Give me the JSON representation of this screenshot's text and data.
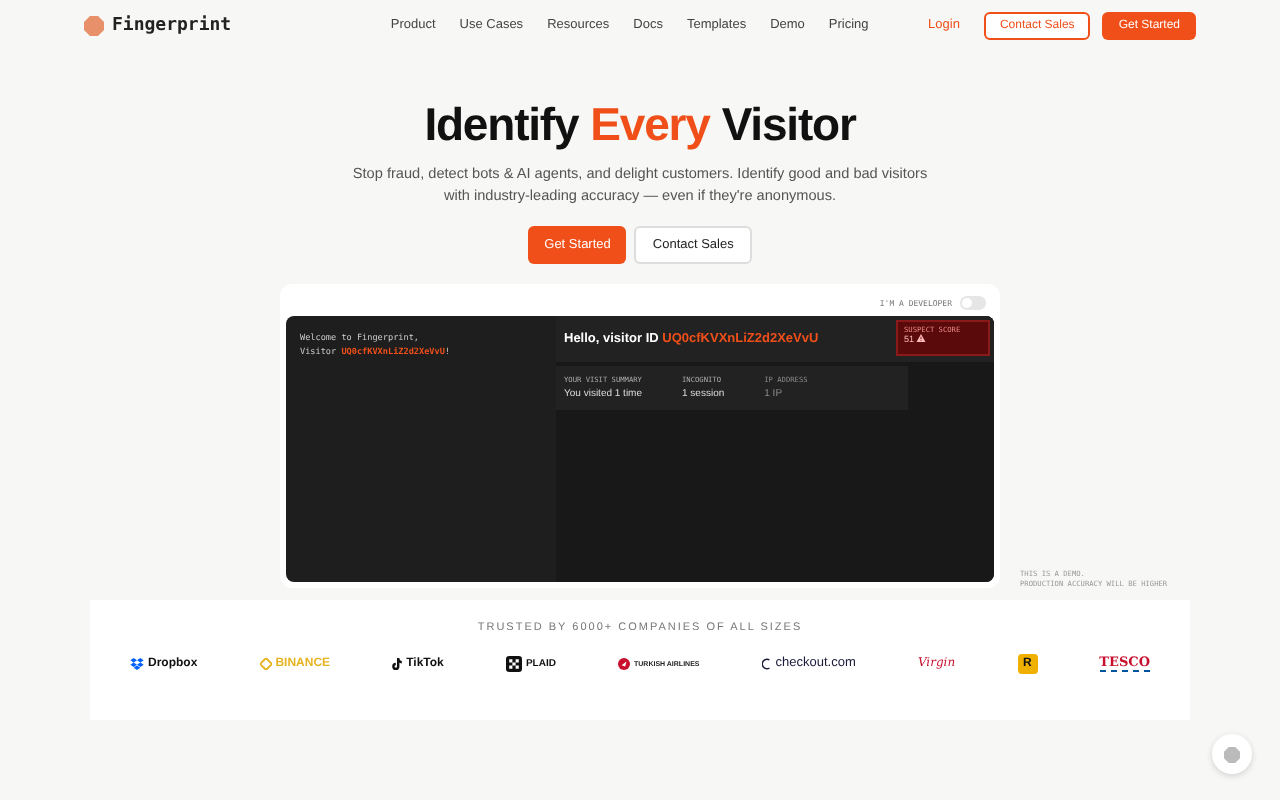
{
  "header": {
    "logo": "Fingerprint",
    "nav": [
      "Product",
      "Use Cases",
      "Resources",
      "Docs",
      "Templates",
      "Demo",
      "Pricing"
    ],
    "login": "Login",
    "contact": "Contact Sales",
    "cta": "Get Started"
  },
  "hero": {
    "title_parts": [
      {
        "text": "Identify",
        "highlighted": false
      },
      {
        "text": "Every",
        "highlighted": true
      },
      {
        "text": "Visitor",
        "highlighted": false
      }
    ],
    "subtitle": "Stop fraud, detect bots & AI agents, and delight customers. Identify good and bad visitors with industry-leading accuracy — even if they're anonymous.",
    "primary_button": "Get Started",
    "secondary_button": "Contact Sales"
  },
  "demo": {
    "developer_label": "I'M A DEVELOPER",
    "developer_on": false,
    "terminal": [
      "Welcome to Fingerprint,",
      "Visitor "
    ],
    "terminal_id": "UQ0cfKVXnLiZ2d2XeVvU",
    "terminal_end": "!",
    "greeting": "Hello, visitor ID",
    "visitor_id": "UQ0cfKVXnLiZ2d2XeVvU",
    "suspect": {
      "label": "SUSPECT SCORE",
      "value": "51"
    },
    "summary": [
      {
        "label": "YOUR VISIT SUMMARY",
        "value": "You visited 1 time",
        "dimmed": false
      },
      {
        "label": "INCOGNITO",
        "value": "1 session",
        "dimmed": false
      },
      {
        "label": "IP ADDRESS",
        "value": "1 IP",
        "dimmed": true
      }
    ],
    "note": [
      "THIS IS A DEMO.",
      "PRODUCTION ACCURACY WILL BE HIGHER"
    ]
  },
  "logos": {
    "heading": "TRUSTED BY 6000+ COMPANIES OF ALL SIZES",
    "items": [
      {
        "kind": "dropbox",
        "name": "Dropbox"
      },
      {
        "kind": "binance",
        "name": "BINANCE"
      },
      {
        "kind": "tiktok",
        "name": "TikTok"
      },
      {
        "kind": "plaid",
        "name": "PLAID"
      },
      {
        "kind": "turkish",
        "name": "TURKISH AIRLINES"
      },
      {
        "kind": "checkout",
        "name": "checkout.com"
      },
      {
        "kind": "virgin",
        "name": "Virgin"
      },
      {
        "kind": "rockstar",
        "name": "R"
      },
      {
        "kind": "tesco",
        "name": "TESCO"
      }
    ]
  }
}
